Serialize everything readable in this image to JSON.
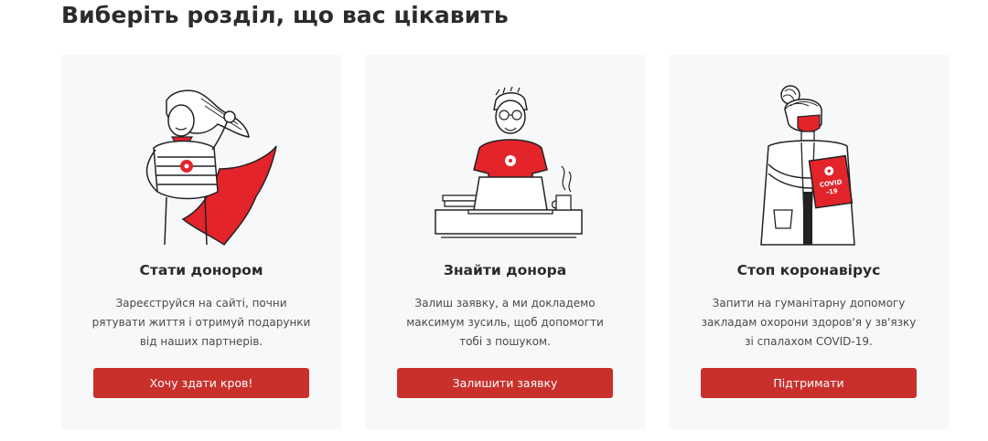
{
  "header": {
    "title": "Виберіть розділ, що вас цікавить"
  },
  "cards": [
    {
      "title": "Стати донором",
      "description": "Зареєструйся на сайті, почни\nрятувати життя і отримуй подарунки\nвід наших партнерів.",
      "button_label": "Хочу здати кров!",
      "illustration": "superhero-donor-illustration"
    },
    {
      "title": "Знайти донора",
      "description": "Залиш заявку, а ми докладемо\nмаксимум зусиль, щоб допомогти\nтобі з пошуком.",
      "button_label": "Залишити заявку",
      "illustration": "person-at-laptop-illustration"
    },
    {
      "title": "Стоп коронавірус",
      "description": "Запити на гуманітарну допомогу\nзакладам охорони здоров'я у зв'язку\nзі спалахом COVID-19.",
      "button_label": "Підтримати",
      "illustration": "doctor-covid-illustration",
      "folder_label": "COVID\n-19"
    }
  ],
  "colors": {
    "accent": "#c9302c",
    "illustration_red": "#e3242b",
    "card_bg": "#f7f8f9"
  }
}
